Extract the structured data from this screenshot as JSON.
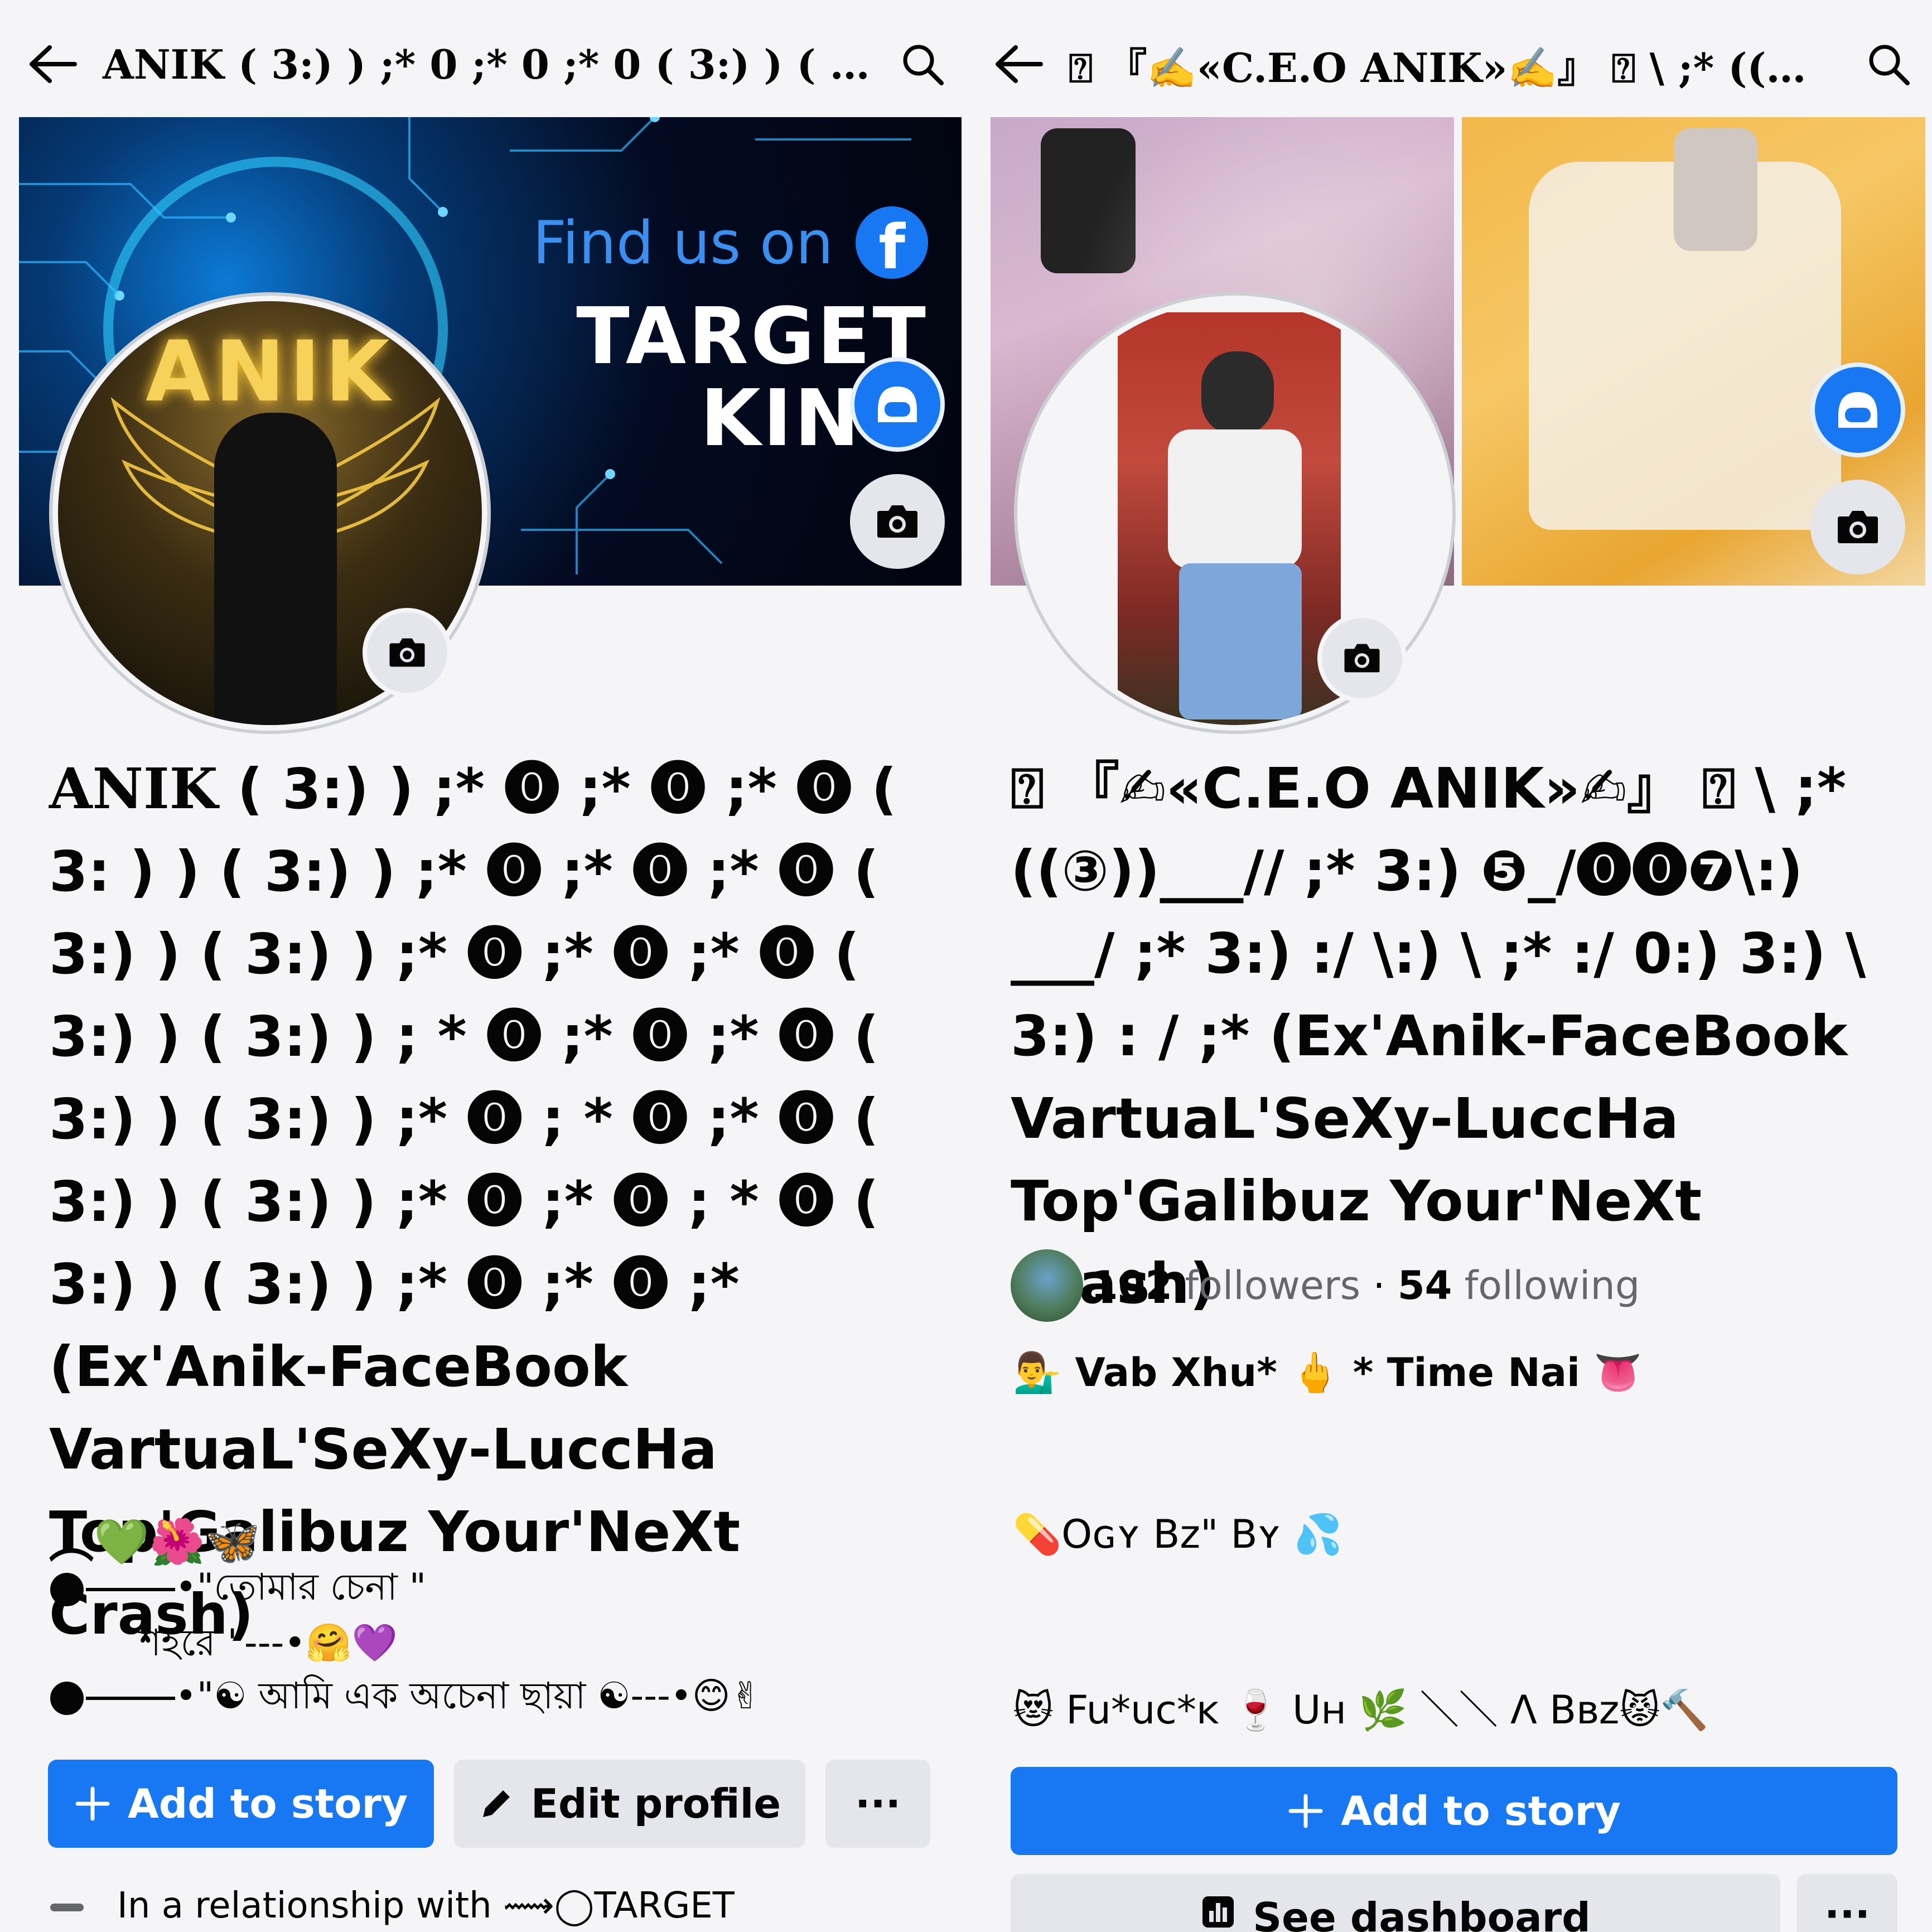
{
  "left": {
    "title": "ANIK ( 3:) ) ;* 0 ;* 0 ;* 0 ( 3:) ) ( …",
    "cover": {
      "find_us": "Find us on",
      "fb_letter": "f",
      "brand_line1": "TARGET",
      "brand_line2": "KING"
    },
    "profile_pic_text": "ANIK",
    "name_head": "ANIK",
    "name_rest": " ( 3:) ) ;* ⓿ ;* ⓿ ;* ⓿ ( 3: ) ) ( 3:) ) ;* ⓿ ;* ⓿ ;* ⓿ ( 3:) ) ( 3:) ) ;* ⓿ ;* ⓿ ;* ⓿ ( 3:) ) ( 3:) ) ; * ⓿ ;* ⓿ ;* ⓿ ( 3:) ) ( 3:) ) ;* ⓿ ; * ⓿ ;* ⓿ ( 3:) ) ( 3:) ) ;* ⓿ ;* ⓿ ; * ⓿ ( 3:) ) ( 3:) ) ;* ⓿ ;* ⓿ ;* (Ex'Anik-FaceBook VartuaL'SeXy-LuccHa Top'Galibuz Your'NeXt Crash)",
    "bio_emojis": "︵💚🌺🦋",
    "bio_line1": "•\"তোমার চেনা \"",
    "bio_line2": "শহরে \"---•🤗💜",
    "bio_line3": "•\"☯ আমি এক অচেনা ছায়া ☯---•😊✌",
    "add_story": "Add to story",
    "edit_profile": "Edit profile",
    "more": "···",
    "relationship": "In a relationship with ⟿◯TARGET"
  },
  "right": {
    "title": "⍰ 『✍«C.E.O ANIK»✍』 ⍰ \\ ;* ((③))___…",
    "name": "⍰ 『✍«C.E.O ANIK»✍』 ⍰ \\ ;* ((③))___// ;* 3:) ❺_/⓿⓿❼\\:) ___/ ;* 3:) :/ \\:) \\ ;* :/ 0:) 3:) \\ 3:) : / ;*   (Ex'Anik-FaceBook VartuaL'SeXy-LuccHa Top'Galibuz Your'NeXt Crash)",
    "followers_count": "102",
    "followers_label": "followers",
    "following_count": "54",
    "following_label": "following",
    "bio_line1": "💁‍♂️ Vab Xhu* 🖕 * Time Nai 👅",
    "bio_line2": "💊Oɢʏ Bz\" Bʏ 💦",
    "bio_line3": "😻 Fu*uc*ᴋ 🍷 Uʜ 🌿 ＼＼ Λ Bʙz😾🔨",
    "add_story": "Add to story",
    "see_dashboard": "See dashboard",
    "more": "···"
  },
  "colors": {
    "primary": "#1877f2",
    "secondary_btn": "#e4e6eb",
    "muted_text": "#65676b",
    "cover_text": "#3b8ff0"
  },
  "icons": [
    "back-arrow-icon",
    "search-icon",
    "camera-icon",
    "avatar-icon",
    "plus-icon",
    "pencil-icon",
    "dashboard-icon"
  ]
}
